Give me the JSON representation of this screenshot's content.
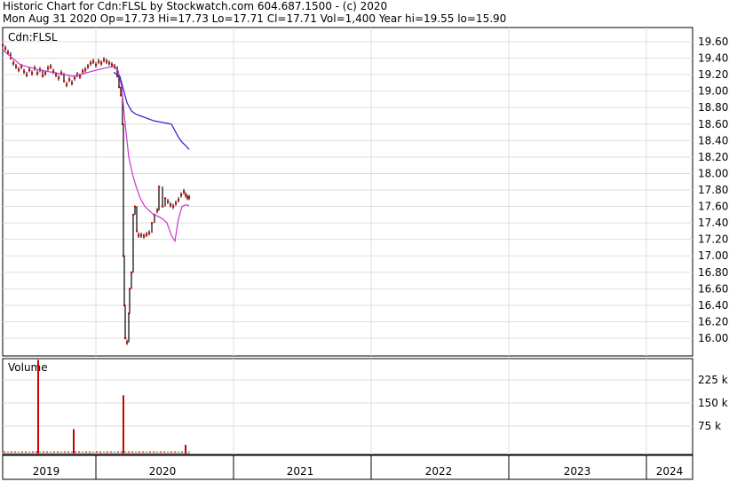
{
  "header": {
    "line1": "Historic Chart for Cdn:FLSL by Stockwatch.com 604.687.1500 - (c) 2020",
    "line2": "Mon Aug 31 2020  Op=17.73  Hi=17.73  Lo=17.71  Cl=17.71  Vol=1,400  Year hi=19.55  lo=15.90"
  },
  "colors": {
    "price": "#cc0000",
    "ma_short": "#cc33cc",
    "ma_long": "#2222cc",
    "volume": "#cc0000",
    "grid": "#dddddd",
    "frame": "#000000"
  },
  "chart_data": [
    {
      "type": "line",
      "title": "Cdn:FLSL",
      "ylim": [
        15.9,
        19.7
      ],
      "yticks": [
        "19.60",
        "19.40",
        "19.20",
        "19.00",
        "18.80",
        "18.60",
        "18.40",
        "18.20",
        "18.00",
        "17.80",
        "17.60",
        "17.40",
        "17.20",
        "17.00",
        "16.80",
        "16.60",
        "16.40",
        "16.20",
        "16.00"
      ],
      "x_years": [
        "2019",
        "2020",
        "2021",
        "2022",
        "2023",
        "2024"
      ],
      "price_points": [
        [
          0,
          19.56
        ],
        [
          3,
          19.52
        ],
        [
          6,
          19.47
        ],
        [
          9,
          19.4
        ],
        [
          12,
          19.34
        ],
        [
          15,
          19.3
        ],
        [
          18,
          19.26
        ],
        [
          21,
          19.3
        ],
        [
          24,
          19.24
        ],
        [
          27,
          19.2
        ],
        [
          30,
          19.26
        ],
        [
          33,
          19.22
        ],
        [
          36,
          19.28
        ],
        [
          39,
          19.22
        ],
        [
          42,
          19.26
        ],
        [
          45,
          19.18
        ],
        [
          48,
          19.22
        ],
        [
          51,
          19.28
        ],
        [
          54,
          19.3
        ],
        [
          57,
          19.24
        ],
        [
          60,
          19.2
        ],
        [
          63,
          19.16
        ],
        [
          66,
          19.22
        ],
        [
          69,
          19.12
        ],
        [
          72,
          19.08
        ],
        [
          75,
          19.14
        ],
        [
          78,
          19.1
        ],
        [
          81,
          19.16
        ],
        [
          84,
          19.2
        ],
        [
          87,
          19.18
        ],
        [
          90,
          19.24
        ],
        [
          93,
          19.26
        ],
        [
          96,
          19.3
        ],
        [
          99,
          19.34
        ],
        [
          102,
          19.36
        ],
        [
          105,
          19.32
        ],
        [
          108,
          19.36
        ],
        [
          111,
          19.34
        ],
        [
          114,
          19.38
        ],
        [
          117,
          19.36
        ],
        [
          120,
          19.34
        ],
        [
          123,
          19.32
        ],
        [
          126,
          19.3
        ],
        [
          129,
          19.18
        ],
        [
          131,
          19.05
        ],
        [
          133,
          18.95
        ],
        [
          135,
          18.6
        ],
        [
          136,
          17.0
        ],
        [
          137,
          16.4
        ],
        [
          138,
          16.0
        ],
        [
          140,
          15.95
        ],
        [
          142,
          16.3
        ],
        [
          143,
          16.6
        ],
        [
          145,
          16.8
        ],
        [
          147,
          17.5
        ],
        [
          149,
          17.6
        ],
        [
          151,
          17.3
        ],
        [
          153,
          17.25
        ],
        [
          156,
          17.25
        ],
        [
          159,
          17.24
        ],
        [
          162,
          17.26
        ],
        [
          165,
          17.28
        ],
        [
          168,
          17.4
        ],
        [
          171,
          17.5
        ],
        [
          174,
          17.55
        ],
        [
          176,
          17.84
        ],
        [
          180,
          17.6
        ],
        [
          183,
          17.7
        ],
        [
          186,
          17.66
        ],
        [
          189,
          17.62
        ],
        [
          192,
          17.6
        ],
        [
          195,
          17.64
        ],
        [
          198,
          17.68
        ],
        [
          201,
          17.74
        ],
        [
          204,
          17.78
        ],
        [
          206,
          17.74
        ],
        [
          208,
          17.71
        ],
        [
          210,
          17.71
        ]
      ],
      "ma_short": [
        [
          0,
          19.5
        ],
        [
          20,
          19.32
        ],
        [
          40,
          19.26
        ],
        [
          60,
          19.22
        ],
        [
          80,
          19.18
        ],
        [
          100,
          19.24
        ],
        [
          115,
          19.28
        ],
        [
          125,
          19.3
        ],
        [
          130,
          19.25
        ],
        [
          134,
          19.05
        ],
        [
          138,
          18.6
        ],
        [
          142,
          18.2
        ],
        [
          146,
          18.0
        ],
        [
          150,
          17.85
        ],
        [
          155,
          17.7
        ],
        [
          160,
          17.6
        ],
        [
          165,
          17.55
        ],
        [
          170,
          17.5
        ],
        [
          175,
          17.48
        ],
        [
          180,
          17.45
        ],
        [
          185,
          17.4
        ],
        [
          190,
          17.25
        ],
        [
          194,
          17.18
        ],
        [
          198,
          17.45
        ],
        [
          202,
          17.6
        ],
        [
          206,
          17.62
        ],
        [
          210,
          17.61
        ]
      ],
      "ma_long": [
        [
          125,
          19.23
        ],
        [
          132,
          19.18
        ],
        [
          136,
          19.02
        ],
        [
          140,
          18.86
        ],
        [
          145,
          18.76
        ],
        [
          150,
          18.72
        ],
        [
          155,
          18.7
        ],
        [
          160,
          18.68
        ],
        [
          165,
          18.66
        ],
        [
          170,
          18.64
        ],
        [
          175,
          18.63
        ],
        [
          180,
          18.62
        ],
        [
          185,
          18.61
        ],
        [
          190,
          18.6
        ],
        [
          194,
          18.52
        ],
        [
          198,
          18.44
        ],
        [
          202,
          18.38
        ],
        [
          206,
          18.34
        ],
        [
          210,
          18.29
        ]
      ]
    },
    {
      "type": "bar",
      "title": "Volume",
      "ylim": [
        0,
        300
      ],
      "yticks": [
        "225 k",
        "150 k",
        "75 k"
      ],
      "unit": "k",
      "bars": [
        [
          40,
          290
        ],
        [
          80,
          65
        ],
        [
          136,
          175
        ],
        [
          206,
          14
        ]
      ]
    }
  ]
}
